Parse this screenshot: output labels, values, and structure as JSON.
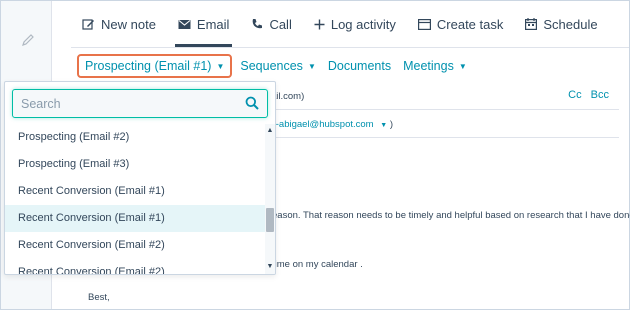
{
  "tabs": [
    {
      "label": "New note",
      "icon": "edit-icon"
    },
    {
      "label": "Email",
      "icon": "envelope-icon"
    },
    {
      "label": "Call",
      "icon": "phone-icon"
    },
    {
      "label": "Log activity",
      "icon": "plus-icon"
    },
    {
      "label": "Create task",
      "icon": "task-icon"
    },
    {
      "label": "Schedule",
      "icon": "calendar-icon"
    }
  ],
  "active_tab": "Email",
  "toolbar": {
    "templates": "Prospecting (Email #1)",
    "sequences": "Sequences",
    "documents": "Documents",
    "meetings": "Meetings"
  },
  "dropdown": {
    "search_placeholder": "Search",
    "items": [
      "Prospecting (Email #2)",
      "Prospecting (Email #3)",
      "Recent Conversion (Email #1)",
      "Recent Conversion (Email #1)",
      "Recent Conversion (Email #2)",
      "Recent Conversion (Email #2)"
    ],
    "hovered_index": 3
  },
  "compose": {
    "to_fragment": "ail.com)",
    "cc": "Cc",
    "bcc": "Bcc",
    "from_fragment": "k-abigael@hubspot.com",
    "body_line1_fragment": "eason. That reason needs to be timely and helpful based on research that I have done on",
    "body_line2_fragment": "time on my calendar .",
    "signoff": "Best,"
  },
  "colors": {
    "accent_link": "#0091ae",
    "highlight_border": "#e8734a",
    "focus_border": "#00bda5",
    "text": "#33475b"
  }
}
